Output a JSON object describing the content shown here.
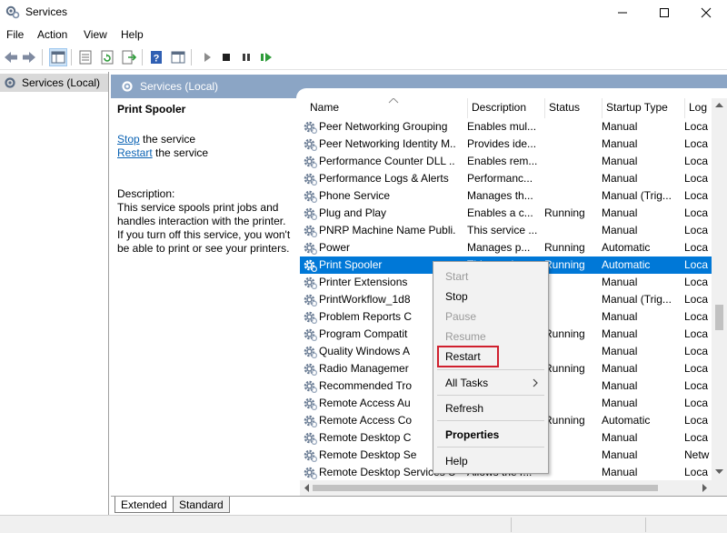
{
  "window": {
    "title": "Services"
  },
  "menu": [
    "File",
    "Action",
    "View",
    "Help"
  ],
  "tree": {
    "root_label": "Services (Local)"
  },
  "pane_header": {
    "label": "Services (Local)"
  },
  "details": {
    "title": "Print Spooler",
    "stop_link": "Stop",
    "stop_suffix": " the service",
    "restart_link": "Restart",
    "restart_suffix": " the service",
    "description_label": "Description:",
    "description_lines": [
      "This service spools print jobs and",
      "handles interaction with the printer.",
      "If you turn off this service, you won't",
      "be able to print or see your printers."
    ]
  },
  "columns": [
    "Name",
    "Description",
    "Status",
    "Startup Type",
    "Log"
  ],
  "services": [
    {
      "name": "Peer Networking Grouping",
      "description": "Enables mul...",
      "status": "",
      "startup": "Manual",
      "log": "Loca"
    },
    {
      "name": "Peer Networking Identity M...",
      "description": "Provides ide...",
      "status": "",
      "startup": "Manual",
      "log": "Loca"
    },
    {
      "name": "Performance Counter DLL ...",
      "description": "Enables rem...",
      "status": "",
      "startup": "Manual",
      "log": "Loca"
    },
    {
      "name": "Performance Logs & Alerts",
      "description": "Performanc...",
      "status": "",
      "startup": "Manual",
      "log": "Loca"
    },
    {
      "name": "Phone Service",
      "description": "Manages th...",
      "status": "",
      "startup": "Manual (Trig...",
      "log": "Loca"
    },
    {
      "name": "Plug and Play",
      "description": "Enables a c...",
      "status": "Running",
      "startup": "Manual",
      "log": "Loca"
    },
    {
      "name": "PNRP Machine Name Publi...",
      "description": "This service ...",
      "status": "",
      "startup": "Manual",
      "log": "Loca"
    },
    {
      "name": "Power",
      "description": "Manages p...",
      "status": "Running",
      "startup": "Automatic",
      "log": "Loca"
    },
    {
      "name": "Print Spooler",
      "description": "This service...",
      "status": "Running",
      "startup": "Automatic",
      "log": "Loca",
      "selected": true
    },
    {
      "name": "Printer Extensions",
      "description": "",
      "status": "",
      "startup": "Manual",
      "log": "Loca"
    },
    {
      "name": "PrintWorkflow_1d8",
      "description": "",
      "status": "",
      "startup": "Manual (Trig...",
      "log": "Loca"
    },
    {
      "name": "Problem Reports C",
      "description": "",
      "status": "",
      "startup": "Manual",
      "log": "Loca"
    },
    {
      "name": "Program Compatit",
      "description": "",
      "status": "Running",
      "startup": "Manual",
      "log": "Loca"
    },
    {
      "name": "Quality Windows A",
      "description": "",
      "status": "",
      "startup": "Manual",
      "log": "Loca"
    },
    {
      "name": "Radio Managemer",
      "description": "",
      "status": "Running",
      "startup": "Manual",
      "log": "Loca"
    },
    {
      "name": "Recommended Tro",
      "description": "",
      "status": "",
      "startup": "Manual",
      "log": "Loca"
    },
    {
      "name": "Remote Access Au",
      "description": "",
      "status": "",
      "startup": "Manual",
      "log": "Loca"
    },
    {
      "name": "Remote Access Co",
      "description": "",
      "status": "Running",
      "startup": "Automatic",
      "log": "Loca"
    },
    {
      "name": "Remote Desktop C",
      "description": "",
      "status": "",
      "startup": "Manual",
      "log": "Loca"
    },
    {
      "name": "Remote Desktop Se",
      "description": "",
      "status": "",
      "startup": "Manual",
      "log": "Netw"
    },
    {
      "name": "Remote Desktop Services U...",
      "description": "Allows the r...",
      "status": "",
      "startup": "Manual",
      "log": "Loca"
    }
  ],
  "context_menu": {
    "start": "Start",
    "stop": "Stop",
    "pause": "Pause",
    "resume": "Resume",
    "restart": "Restart",
    "all_tasks": "All Tasks",
    "refresh": "Refresh",
    "properties": "Properties",
    "help": "Help"
  },
  "tabs": {
    "extended": "Extended",
    "standard": "Standard"
  },
  "colors": {
    "accent": "#0078d7",
    "header_band": "#8ba5c5",
    "highlight_box": "#d0202e",
    "link": "#0b63b4"
  },
  "icons": {
    "app": "services-gear-icon",
    "row": "service-gear-icon"
  }
}
